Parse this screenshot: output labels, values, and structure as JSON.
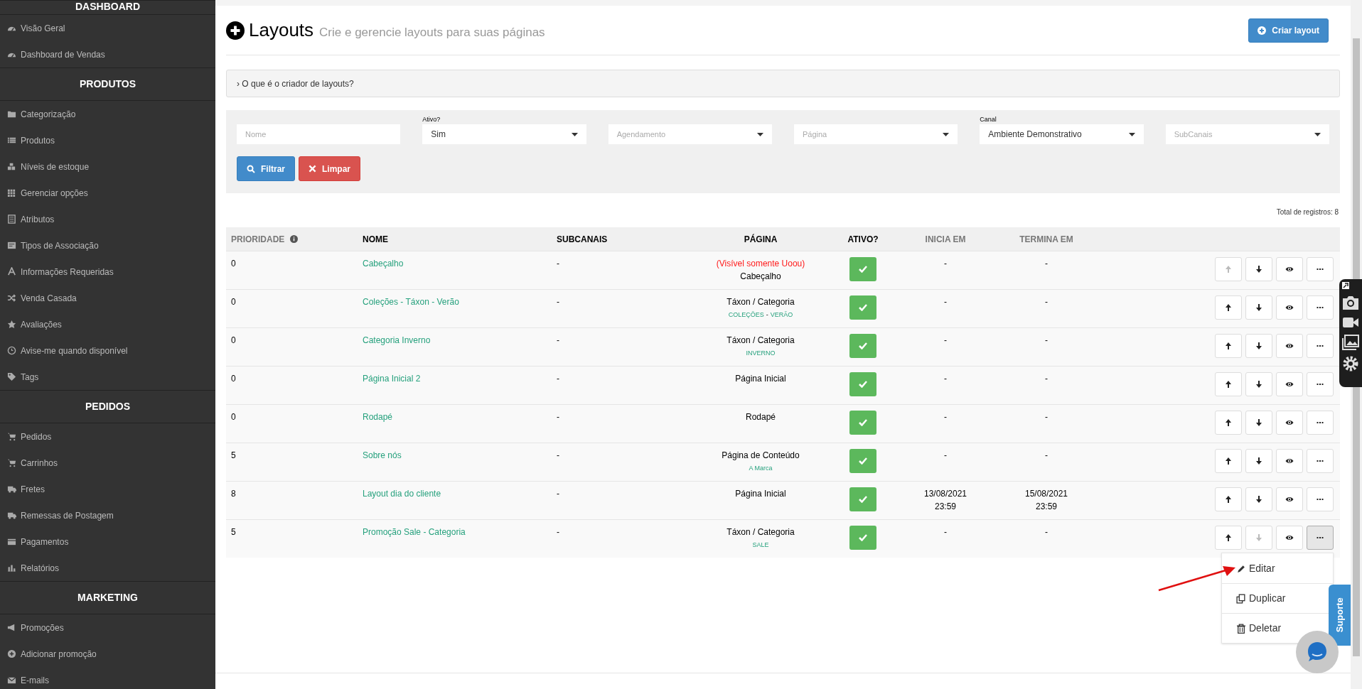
{
  "sidebar": {
    "sections": [
      {
        "title": "DASHBOARD",
        "items": [
          "Visão Geral",
          "Dashboard de Vendas"
        ]
      },
      {
        "title": "PRODUTOS",
        "items": [
          "Categorização",
          "Produtos",
          "Níveis de estoque",
          "Gerenciar opções",
          "Atributos",
          "Tipos de Associação",
          "Informações Requeridas",
          "Venda Casada",
          "Avaliações",
          "Avise-me quando disponível",
          "Tags"
        ]
      },
      {
        "title": "PEDIDOS",
        "items": [
          "Pedidos",
          "Carrinhos",
          "Fretes",
          "Remessas de Postagem",
          "Pagamentos",
          "Relatórios"
        ]
      },
      {
        "title": "MARKETING",
        "items": [
          "Promoções",
          "Adicionar promoção",
          "E-mails"
        ]
      }
    ]
  },
  "header": {
    "title": "Layouts",
    "subtitle": "Crie e gerencie layouts para suas páginas",
    "create_button": "Criar layout"
  },
  "help_panel": {
    "label": "› O que é o criador de layouts?",
    "expanded": false
  },
  "filters": {
    "fields": [
      {
        "kind": "text",
        "placeholder": "Nome"
      },
      {
        "kind": "select",
        "label": "Ativo?",
        "value": "Sim"
      },
      {
        "kind": "select",
        "placeholder": "Agendamento"
      },
      {
        "kind": "select",
        "placeholder": "Página"
      },
      {
        "kind": "select",
        "label": "Canal",
        "value": "Ambiente Demonstrativo"
      },
      {
        "kind": "select",
        "placeholder": "SubCanais"
      }
    ],
    "filter_button": "Filtrar",
    "clear_button": "Limpar"
  },
  "total": "Total de registros: 8",
  "table": {
    "columns": [
      {
        "label": "PRIORIDADE",
        "muted": true,
        "info": true
      },
      {
        "label": "NOME",
        "muted": false
      },
      {
        "label": "SUBCANAIS",
        "muted": false
      },
      {
        "label": "PÁGINA",
        "muted": false
      },
      {
        "label": "ATIVO?",
        "muted": false
      },
      {
        "label": "INICIA EM",
        "muted": true
      },
      {
        "label": "TERMINA EM",
        "muted": true
      }
    ],
    "rows": [
      {
        "priority": "0",
        "name": "Cabeçalho",
        "subchannels": "-",
        "page_note": "(Visível somente Uoou)",
        "page": "Cabeçalho",
        "active": true,
        "starts": [
          "-"
        ],
        "ends": [
          "-"
        ],
        "up_disabled": true,
        "down_disabled": false,
        "menu_open": false
      },
      {
        "priority": "0",
        "name": "Coleções - Táxon - Verão",
        "subchannels": "-",
        "page": "Táxon / Categoria",
        "tags": [
          "COLEÇÕES",
          "-",
          "VERÃO"
        ],
        "active": true,
        "starts": [
          "-"
        ],
        "ends": [
          "-"
        ],
        "up_disabled": false,
        "down_disabled": false,
        "menu_open": false
      },
      {
        "priority": "0",
        "name": "Categoria Inverno",
        "subchannels": "-",
        "page": "Táxon / Categoria",
        "tags": [
          "INVERNO"
        ],
        "active": true,
        "starts": [
          "-"
        ],
        "ends": [
          "-"
        ],
        "up_disabled": false,
        "down_disabled": false,
        "menu_open": false
      },
      {
        "priority": "0",
        "name": "Página Inicial 2",
        "subchannels": "-",
        "page": "Página Inicial",
        "active": true,
        "starts": [
          "-"
        ],
        "ends": [
          "-"
        ],
        "up_disabled": false,
        "down_disabled": false,
        "menu_open": false
      },
      {
        "priority": "0",
        "name": "Rodapé",
        "subchannels": "-",
        "page": "Rodapé",
        "active": true,
        "starts": [
          "-"
        ],
        "ends": [
          "-"
        ],
        "up_disabled": false,
        "down_disabled": false,
        "menu_open": false
      },
      {
        "priority": "5",
        "name": "Sobre nós",
        "subchannels": "-",
        "page": "Página de Conteúdo",
        "tags": [
          "A Marca"
        ],
        "active": true,
        "starts": [
          "-"
        ],
        "ends": [
          "-"
        ],
        "up_disabled": false,
        "down_disabled": false,
        "menu_open": false
      },
      {
        "priority": "8",
        "name": "Layout dia do cliente",
        "subchannels": "-",
        "page": "Página Inicial",
        "active": true,
        "starts": [
          "13/08/2021",
          "23:59"
        ],
        "ends": [
          "15/08/2021",
          "23:59"
        ],
        "up_disabled": false,
        "down_disabled": false,
        "menu_open": false
      },
      {
        "priority": "5",
        "name": "Promoção Sale - Categoria",
        "subchannels": "-",
        "page": "Táxon / Categoria",
        "tags": [
          "SALE"
        ],
        "active": true,
        "starts": [
          "-"
        ],
        "ends": [
          "-"
        ],
        "up_disabled": false,
        "down_disabled": true,
        "menu_open": true
      }
    ]
  },
  "row_menu": {
    "items": [
      "Editar",
      "Duplicar",
      "Deletar"
    ]
  },
  "support_tab": "Suporte"
}
